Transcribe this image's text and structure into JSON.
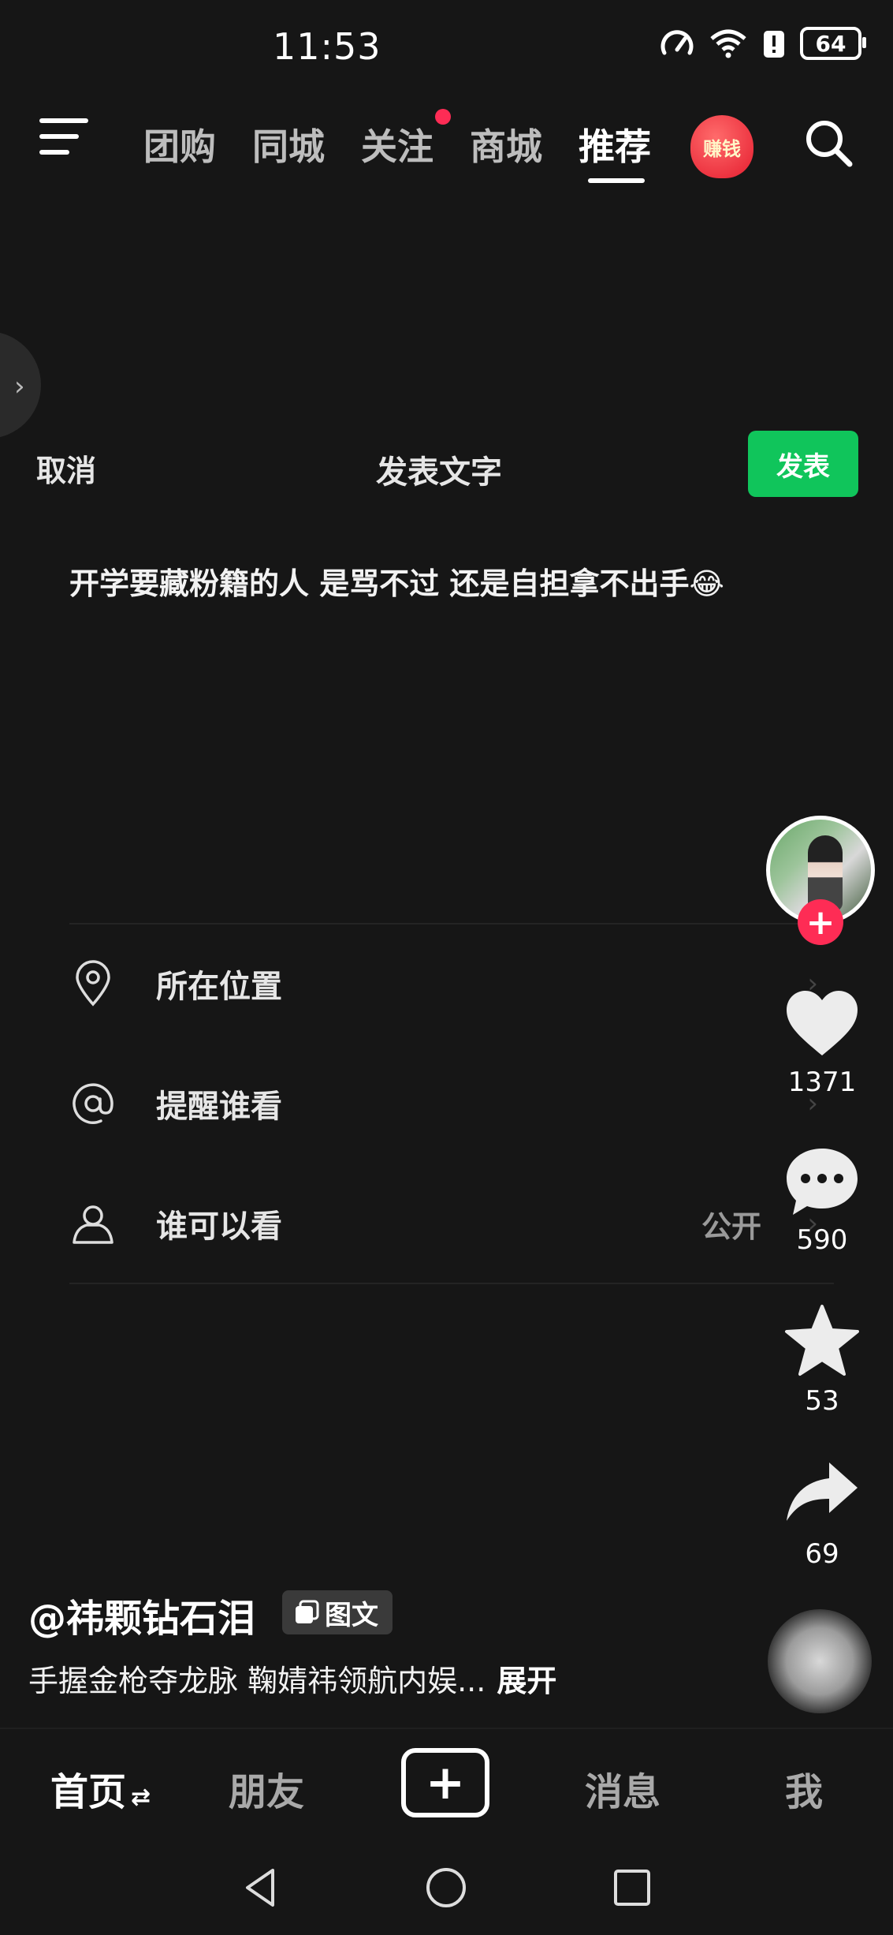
{
  "status_bar": {
    "time": "11:53",
    "battery": "64"
  },
  "top_nav": {
    "tabs": [
      {
        "label": "团购"
      },
      {
        "label": "同城"
      },
      {
        "label": "关注"
      },
      {
        "label": "商城"
      },
      {
        "label": "推荐"
      }
    ],
    "active_tab": "推荐",
    "earn_badge": "赚钱"
  },
  "composer": {
    "cancel_label": "取消",
    "title": "发表文字",
    "publish_label": "发表",
    "text": "开学要藏粉籍的人 是骂不过 还是自担拿不出手😂",
    "settings": [
      {
        "label": "所在位置",
        "icon": "location-pin-icon"
      },
      {
        "label": "提醒谁看",
        "icon": "at-icon"
      },
      {
        "label": "谁可以看",
        "icon": "person-icon",
        "value": "公开"
      }
    ]
  },
  "rail": {
    "likes": "1371",
    "comments": "590",
    "favorites": "53",
    "shares": "69"
  },
  "caption": {
    "author": "@祎颗钻石泪",
    "type_chip": "图文",
    "text": "手握金枪夺龙脉 鞠婧祎领航内娱...",
    "expand_label": "展开"
  },
  "bottom_nav": {
    "home": "首页",
    "friends": "朋友",
    "messages": "消息",
    "me": "我"
  },
  "colors": {
    "accent_red": "#fe2c55",
    "publish_green": "#10c55b",
    "background": "#161616"
  }
}
